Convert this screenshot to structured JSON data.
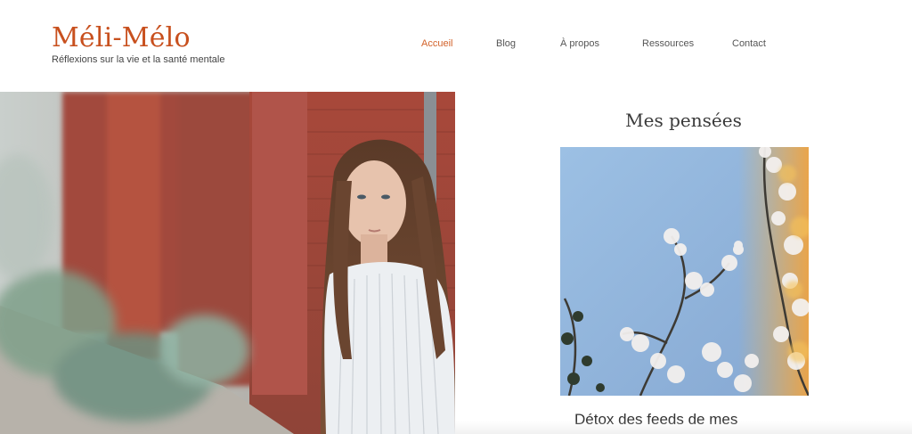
{
  "header": {
    "logo": "Méli-Mélo",
    "tagline": "Réflexions sur la vie et la santé mentale"
  },
  "nav": {
    "items": [
      {
        "label": "Accueil",
        "active": true
      },
      {
        "label": "Blog",
        "active": false
      },
      {
        "label": "À propos",
        "active": false
      },
      {
        "label": "Ressources",
        "active": false
      },
      {
        "label": "Contact",
        "active": false
      }
    ]
  },
  "main": {
    "section_title": "Mes pensées",
    "post": {
      "title": "Détox des feeds de mes"
    }
  },
  "colors": {
    "accent": "#c8501e",
    "nav_active": "#d2622a",
    "sky": "#9cc0e4"
  }
}
